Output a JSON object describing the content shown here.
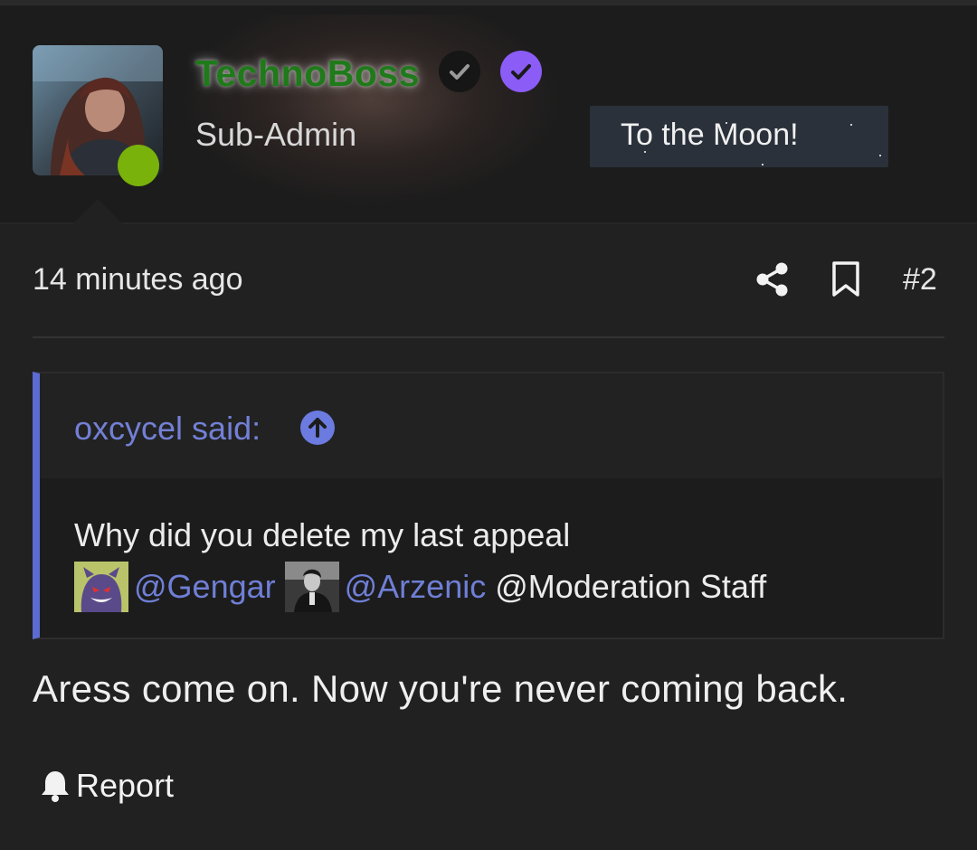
{
  "post": {
    "author": {
      "name": "TechnoBoss",
      "role": "Sub-Admin",
      "status": "online",
      "banner": "To the Moon!",
      "name_color": "#1f7a1a",
      "status_color": "#78b20a"
    },
    "timestamp": "14 minutes ago",
    "number": "#2",
    "actions": {
      "share_icon": "share-icon",
      "bookmark_icon": "bookmark-icon"
    },
    "quote": {
      "author_label": "oxcycel said:",
      "text": "Why did you delete my last appeal",
      "mentions": [
        {
          "label": "@Gengar",
          "has_avatar": true
        },
        {
          "label": "@Arzenic",
          "has_avatar": true
        },
        {
          "label": "@Moderation Staff",
          "has_avatar": false
        }
      ],
      "accent_color": "#5b6bd0"
    },
    "body": "Aress come on. Now you're never coming back.",
    "report_label": "Report"
  }
}
